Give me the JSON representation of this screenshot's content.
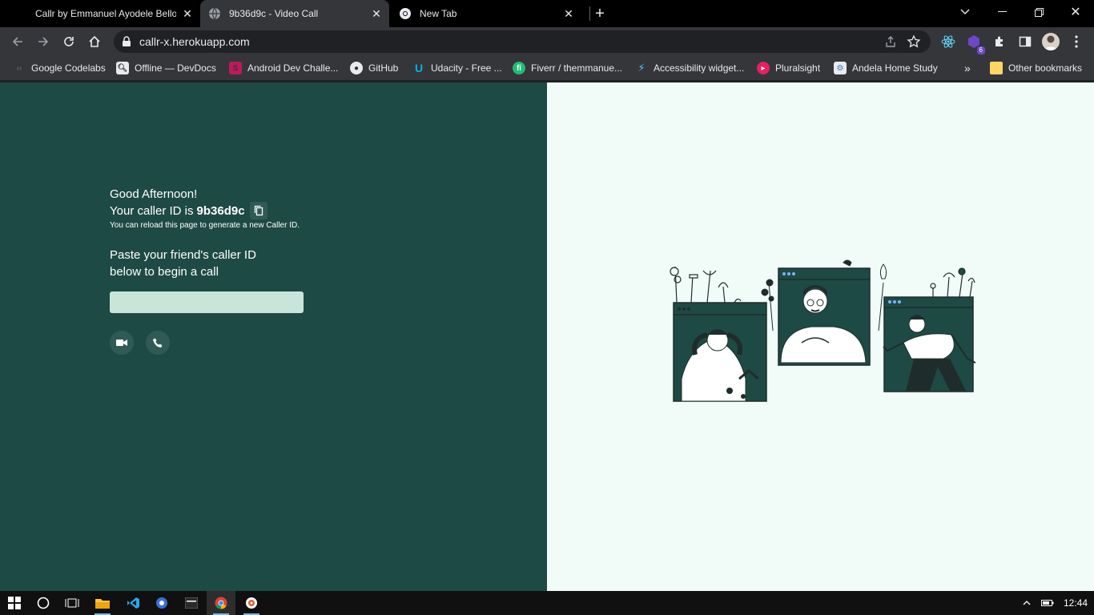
{
  "browser": {
    "tabs": [
      {
        "title": "Callr by Emmanuel Ayodele Bello"
      },
      {
        "title": "9b36d9c - Video Call"
      },
      {
        "title": "New Tab"
      }
    ],
    "url": "callr-x.herokuapp.com",
    "extension_badge": "6",
    "bookmarks": [
      {
        "label": "Google Codelabs",
        "color": "#5f6368"
      },
      {
        "label": "Offline — DevDocs",
        "color": "#e8eaed"
      },
      {
        "label": "Android Dev Challe...",
        "color": "#c2185b"
      },
      {
        "label": "GitHub",
        "color": "#e8eaed"
      },
      {
        "label": "Udacity - Free ...",
        "color": "#02b3e4"
      },
      {
        "label": "Fiverr / themmanue...",
        "color": "#1dbf73"
      },
      {
        "label": "Accessibility widget...",
        "color": "#54c5f8"
      },
      {
        "label": "Pluralsight",
        "color": "#e91e63"
      },
      {
        "label": "Andela Home Study",
        "color": "#3b73c5"
      }
    ],
    "bookmarks_overflow": "»",
    "other_bookmarks": "Other bookmarks"
  },
  "page": {
    "greeting": "Good Afternoon!",
    "caller_prefix": "Your caller ID is",
    "caller_id": "9b36d9c",
    "reload_hint": "You can reload this page to generate a new Caller ID.",
    "paste_line1": "Paste your friend's caller ID",
    "paste_line2": "below to begin a call",
    "input_value": "",
    "colors": {
      "left_bg": "#1e4a45",
      "right_bg": "#f1fcf8",
      "input_bg": "#c9e5da",
      "accent": "#2f5a55"
    }
  },
  "taskbar": {
    "clock": "12:44"
  }
}
